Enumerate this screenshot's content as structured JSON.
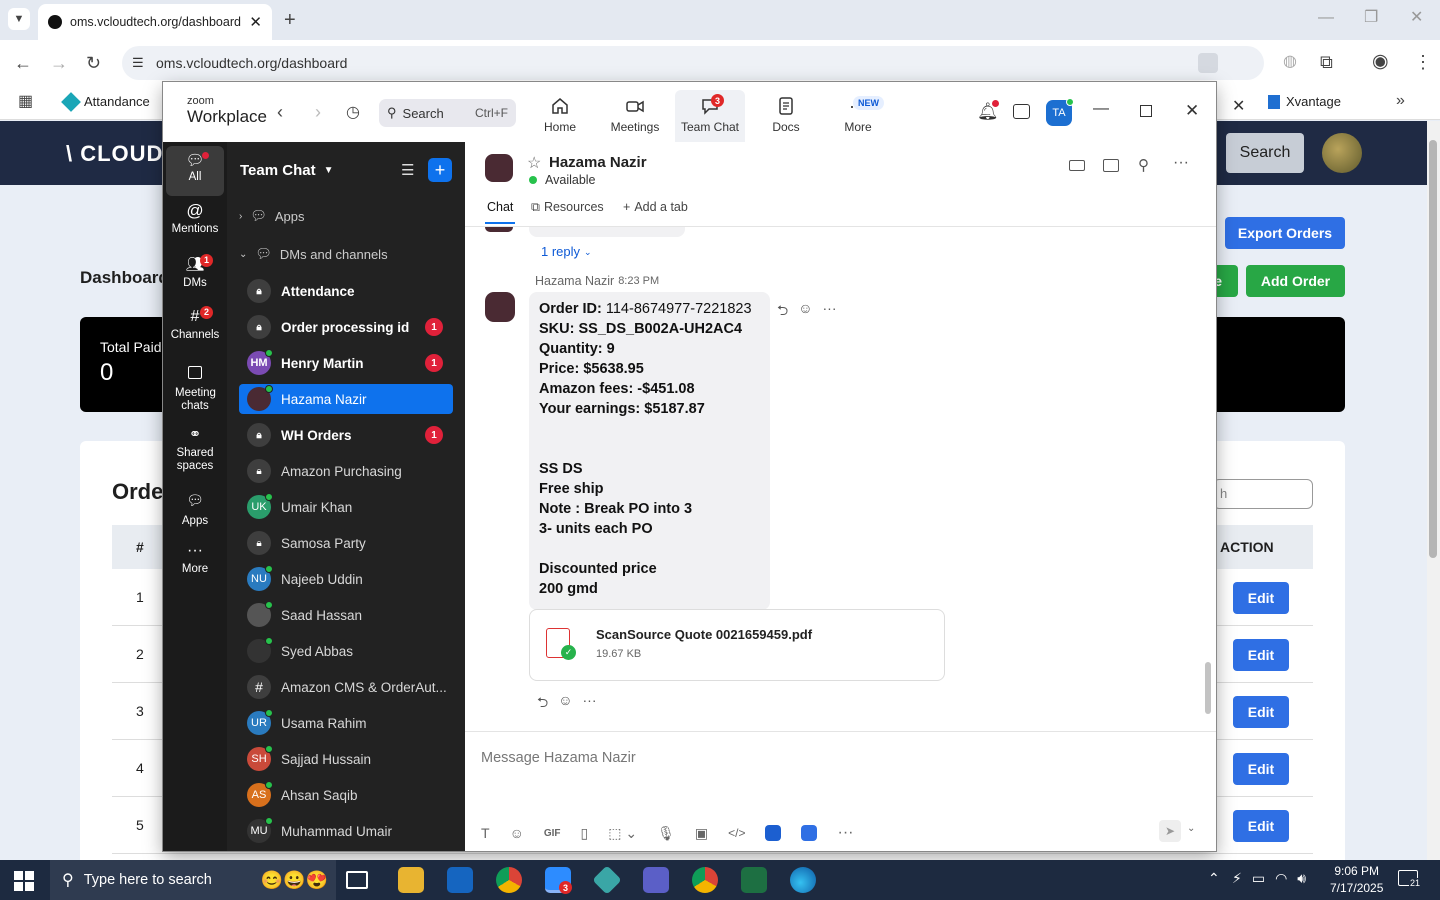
{
  "browser": {
    "tab_title": "oms.vcloudtech.org/dashboard",
    "url": "oms.vcloudtech.org/dashboard",
    "bookmarks": [
      "Attandance",
      "Xvantage"
    ]
  },
  "web": {
    "logo": "\\ CLOUDC",
    "search_label": "Search",
    "dashboard_title": "Dashboard",
    "export_button": "Export Orders",
    "partial_button": "e",
    "add_order_button": "Add Order",
    "card_label": "Total Paid",
    "card_value": "0",
    "orders_title": "Orde",
    "search_partial": "h",
    "table_header_num": "#",
    "table_header_action": "ACTION",
    "rows": [
      "1",
      "2",
      "3",
      "4",
      "5"
    ],
    "edit_label": "Edit"
  },
  "zoom": {
    "brand_small": "zoom",
    "brand_big": "Workplace",
    "search_placeholder": "Search",
    "search_shortcut": "Ctrl+F",
    "tabs": [
      {
        "label": "Home"
      },
      {
        "label": "Meetings"
      },
      {
        "label": "Team Chat",
        "badge": "3"
      },
      {
        "label": "Docs"
      },
      {
        "label": "More",
        "tag": "NEW"
      }
    ],
    "user_initials": "TA",
    "rail": [
      {
        "label": "All"
      },
      {
        "label": "Mentions"
      },
      {
        "label": "DMs",
        "badge": "1"
      },
      {
        "label": "Channels",
        "badge": "2"
      },
      {
        "label": "Meeting chats"
      },
      {
        "label": "Shared spaces"
      },
      {
        "label": "Apps"
      },
      {
        "label": "More"
      }
    ],
    "sidebar_title": "Team Chat",
    "sections": {
      "apps": "Apps",
      "dms": "DMs and channels"
    },
    "channels": [
      {
        "name": "Attendance",
        "avatar": "lock",
        "bold": true
      },
      {
        "name": "Order processing id",
        "avatar": "lock",
        "bold": true,
        "badge": "1"
      },
      {
        "name": "Henry Martin",
        "avatar": "HM",
        "color": "#7b4bb3",
        "bold": true,
        "badge": "1"
      },
      {
        "name": "Hazama Nazir",
        "avatar": "photo",
        "color": "#4a2a33",
        "selected": true
      },
      {
        "name": "WH Orders",
        "avatar": "lock",
        "bold": true,
        "badge": "1"
      },
      {
        "name": "Amazon Purchasing",
        "avatar": "lock"
      },
      {
        "name": "Umair Khan",
        "avatar": "UK",
        "color": "#2a9d6b"
      },
      {
        "name": "Samosa Party",
        "avatar": "lock"
      },
      {
        "name": "Najeeb Uddin",
        "avatar": "NU",
        "color": "#2a7bbf"
      },
      {
        "name": "Saad Hassan",
        "avatar": "photo",
        "color": "#555"
      },
      {
        "name": "Syed Abbas",
        "avatar": "photo",
        "color": "#333"
      },
      {
        "name": "Amazon CMS & OrderAut...",
        "avatar": "hash"
      },
      {
        "name": "Usama Rahim",
        "avatar": "UR",
        "color": "#2a7bbf"
      },
      {
        "name": "Sajjad Hussain",
        "avatar": "SH",
        "color": "#c94a3a"
      },
      {
        "name": "Ahsan Saqib",
        "avatar": "AS",
        "color": "#d8701c"
      },
      {
        "name": "Muhammad Umair",
        "avatar": "MU",
        "color": "#333"
      }
    ],
    "chat": {
      "contact_name": "Hazama Nazir",
      "status": "Available",
      "tabs": [
        "Chat",
        "Resources",
        "Add a tab"
      ],
      "reply_count": "1 reply",
      "sender": "Hazama Nazir",
      "time": "8:23 PM",
      "message": [
        {
          "k": "Order ID:",
          "v": " 114-8674977-7221823"
        },
        {
          "k": "SKU: SS_DS_B002A-UH2AC4",
          "v": ""
        },
        {
          "k": "Quantity: 9",
          "v": ""
        },
        {
          "k": "Price: $5638.95",
          "v": ""
        },
        {
          "k": "Amazon fees: -$451.08",
          "v": ""
        },
        {
          "k": "Your earnings: $5187.87",
          "v": ""
        },
        {
          "k": "",
          "v": ""
        },
        {
          "k": "",
          "v": ""
        },
        {
          "k": "SS DS",
          "v": ""
        },
        {
          "k": "Free ship",
          "v": ""
        },
        {
          "k": "Note : Break PO into 3",
          "v": ""
        },
        {
          "k": "3- units each PO",
          "v": ""
        },
        {
          "k": "",
          "v": ""
        },
        {
          "k": "Discounted price",
          "v": ""
        },
        {
          "k": "200 gmd",
          "v": ""
        }
      ],
      "file_name": "ScanSource Quote 0021659459.pdf",
      "file_size": "19.67 KB",
      "input_placeholder": "Message Hazama Nazir"
    }
  },
  "taskbar": {
    "search_placeholder": "Type here to search",
    "zoom_badge": "3",
    "time": "9:06 PM",
    "date": "7/17/2025",
    "notif_count": "21"
  },
  "colors": {
    "zoom_blue": "#0e72ed",
    "badge_red": "#e0213a",
    "web_blue": "#2f6fe4",
    "web_green": "#28a745"
  }
}
